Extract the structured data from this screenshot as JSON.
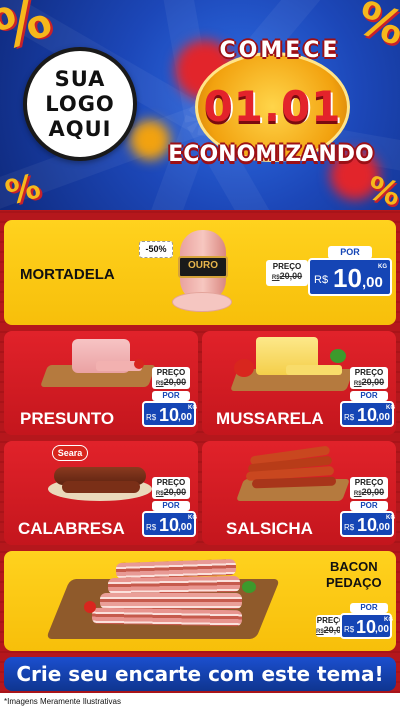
{
  "hero": {
    "logo_lines": [
      "SUA",
      "LOGO",
      "AQUI"
    ],
    "headline_top": "COMECE",
    "headline_date": "01.01",
    "headline_bottom": "ECONOMIZANDO",
    "percent_symbol": "%"
  },
  "products": [
    {
      "name": "MORTADELA",
      "discount_badge": "-50%",
      "brand": "OURO",
      "preco_label": "PREÇO",
      "old_currency": "R$",
      "old_price": "20,00",
      "por_label": "POR",
      "currency": "R$",
      "price_int": "10",
      "price_dec": ",00",
      "unit": "KG"
    },
    {
      "name": "PRESUNTO",
      "preco_label": "PREÇO",
      "old_currency": "R$",
      "old_price": "20,00",
      "por_label": "POR",
      "currency": "R$",
      "price_int": "10",
      "price_dec": ",00",
      "unit": "KG"
    },
    {
      "name": "MUSSARELA",
      "preco_label": "PREÇO",
      "old_currency": "R$",
      "old_price": "20,00",
      "por_label": "POR",
      "currency": "R$",
      "price_int": "10",
      "price_dec": ",00",
      "unit": "KG"
    },
    {
      "name": "CALABRESA",
      "brand": "Seara",
      "preco_label": "PREÇO",
      "old_currency": "R$",
      "old_price": "20,00",
      "por_label": "POR",
      "currency": "R$",
      "price_int": "10",
      "price_dec": ",00",
      "unit": "KG"
    },
    {
      "name": "SALSICHA",
      "preco_label": "PREÇO",
      "old_currency": "R$",
      "old_price": "20,00",
      "por_label": "POR",
      "currency": "R$",
      "price_int": "10",
      "price_dec": ",00",
      "unit": "KG"
    },
    {
      "name_line1": "BACON",
      "name_line2": "PEDAÇO",
      "preco_label": "PREÇO",
      "old_currency": "R$",
      "old_price": "20,00",
      "por_label": "POR",
      "currency": "R$",
      "price_int": "10",
      "price_dec": ",00",
      "unit": "KG"
    }
  ],
  "cta": "Crie seu encarte com este tema!",
  "disclaimer": "*Imagens Meramente Ilustrativas",
  "colors": {
    "blue": "#1545b5",
    "red": "#c4161d",
    "yellow": "#f7bf0a"
  }
}
